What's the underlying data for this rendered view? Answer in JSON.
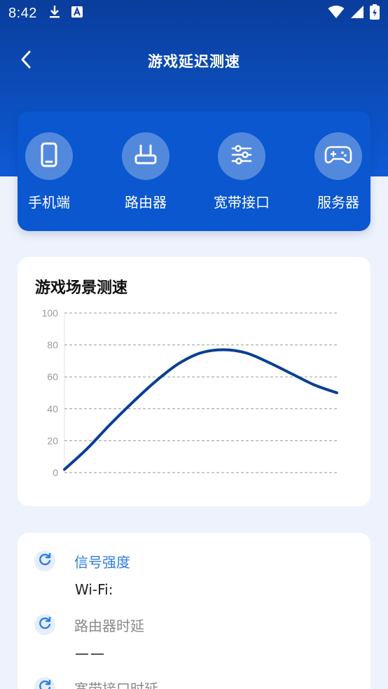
{
  "status_bar": {
    "time": "8:42",
    "icons": [
      "download-icon",
      "a-notification-icon",
      "wifi-icon",
      "signal-icon",
      "battery-icon"
    ]
  },
  "header": {
    "title": "游戏延迟测速",
    "back_icon": "chevron-left-icon"
  },
  "nav": {
    "items": [
      {
        "label": "手机端",
        "icon": "phone-icon"
      },
      {
        "label": "路由器",
        "icon": "router-icon"
      },
      {
        "label": "宽带接口",
        "icon": "sliders-icon"
      },
      {
        "label": "服务器",
        "icon": "gamepad-icon"
      }
    ]
  },
  "chart_section": {
    "title": "游戏场景测速"
  },
  "chart_data": {
    "type": "line",
    "title": "游戏场景测速",
    "xlabel": "",
    "ylabel": "",
    "ylim": [
      0,
      100
    ],
    "yticks": [
      "100",
      "80",
      "60",
      "40",
      "20",
      "0"
    ],
    "grid": true,
    "series": [
      {
        "color": "#0a3f94",
        "x": [
          0,
          1,
          2,
          3,
          4,
          5,
          6,
          7,
          8,
          9,
          10,
          11,
          12
        ],
        "values": [
          2,
          15,
          30,
          44,
          57,
          68,
          75,
          77,
          75,
          69,
          62,
          55,
          50
        ]
      }
    ]
  },
  "info": {
    "rows": [
      {
        "label": "信号强度",
        "value": "Wi-Fi:",
        "icon": "refresh-icon",
        "active": true
      },
      {
        "label": "路由器时延",
        "value": "——",
        "icon": "refresh-icon",
        "active": false
      },
      {
        "label": "宽带接口时延",
        "value": "",
        "icon": "refresh-icon",
        "active": false
      }
    ]
  },
  "colors": {
    "header_dark": "#0a3d9c",
    "nav_card": "#0a57cf",
    "accent_blue": "#2f7de1",
    "page_bg": "#eef2fc",
    "line": "#0a3f94"
  }
}
